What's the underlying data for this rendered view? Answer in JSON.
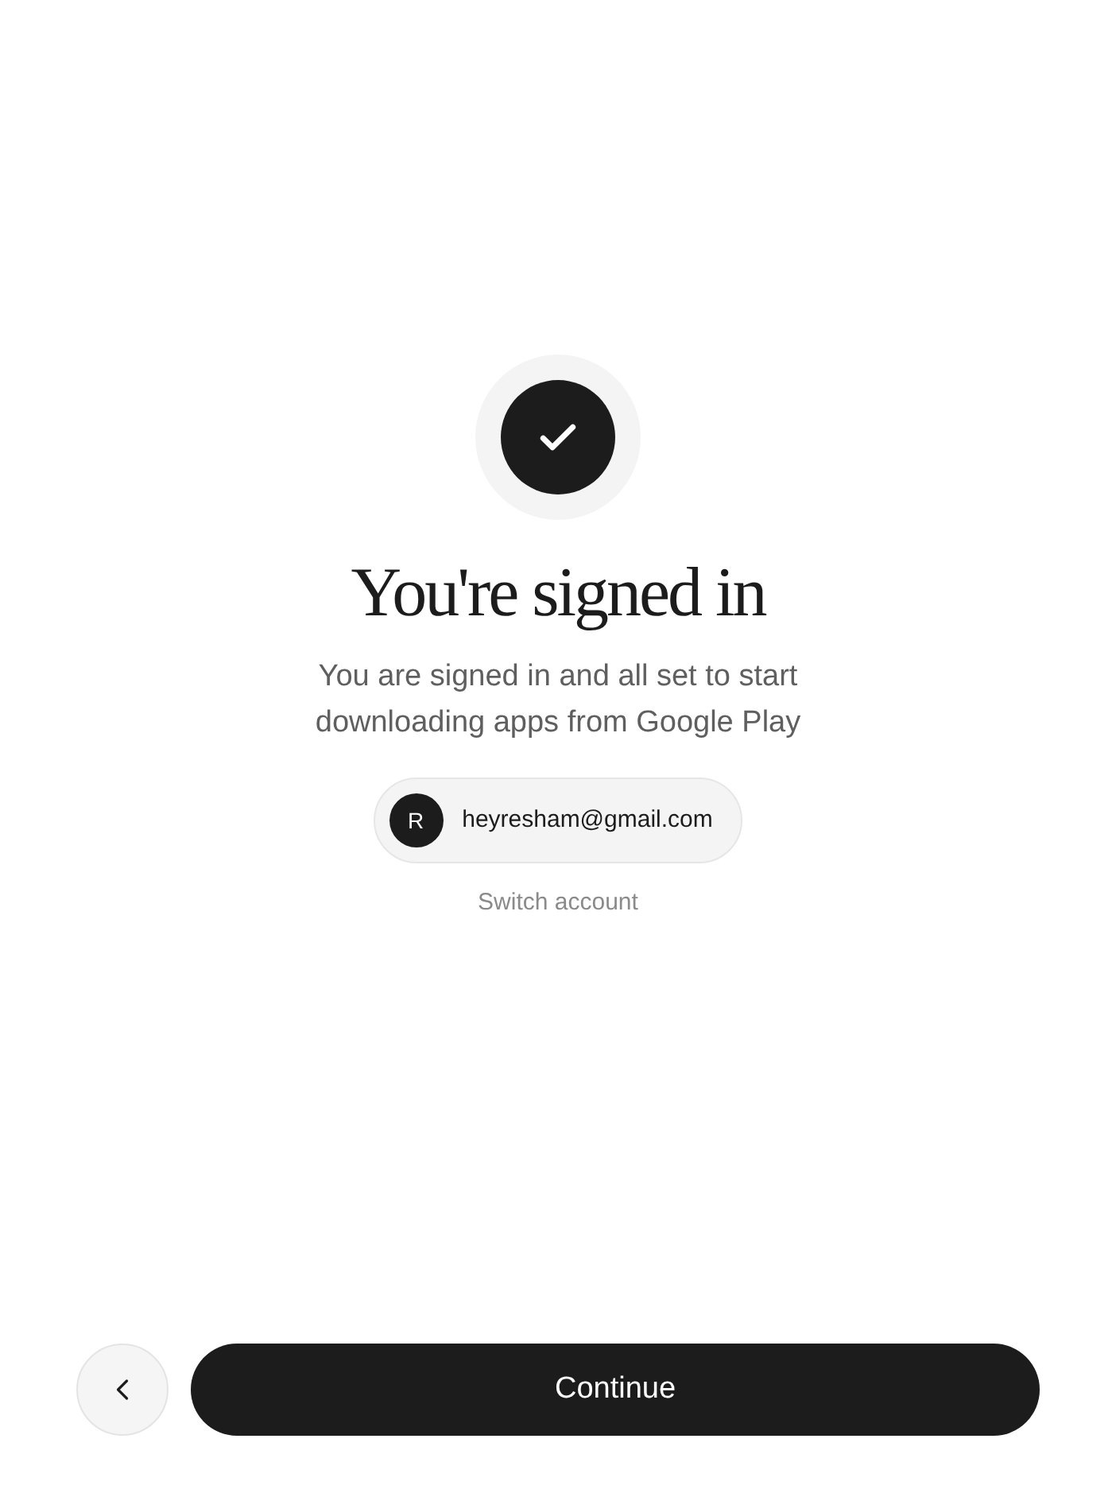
{
  "title": "You're signed in",
  "description": "You are signed in and all set to start downloading apps from Google Play",
  "account": {
    "initial": "R",
    "email": "heyresham@gmail.com"
  },
  "switch_link": "Switch account",
  "continue_button": "Continue"
}
